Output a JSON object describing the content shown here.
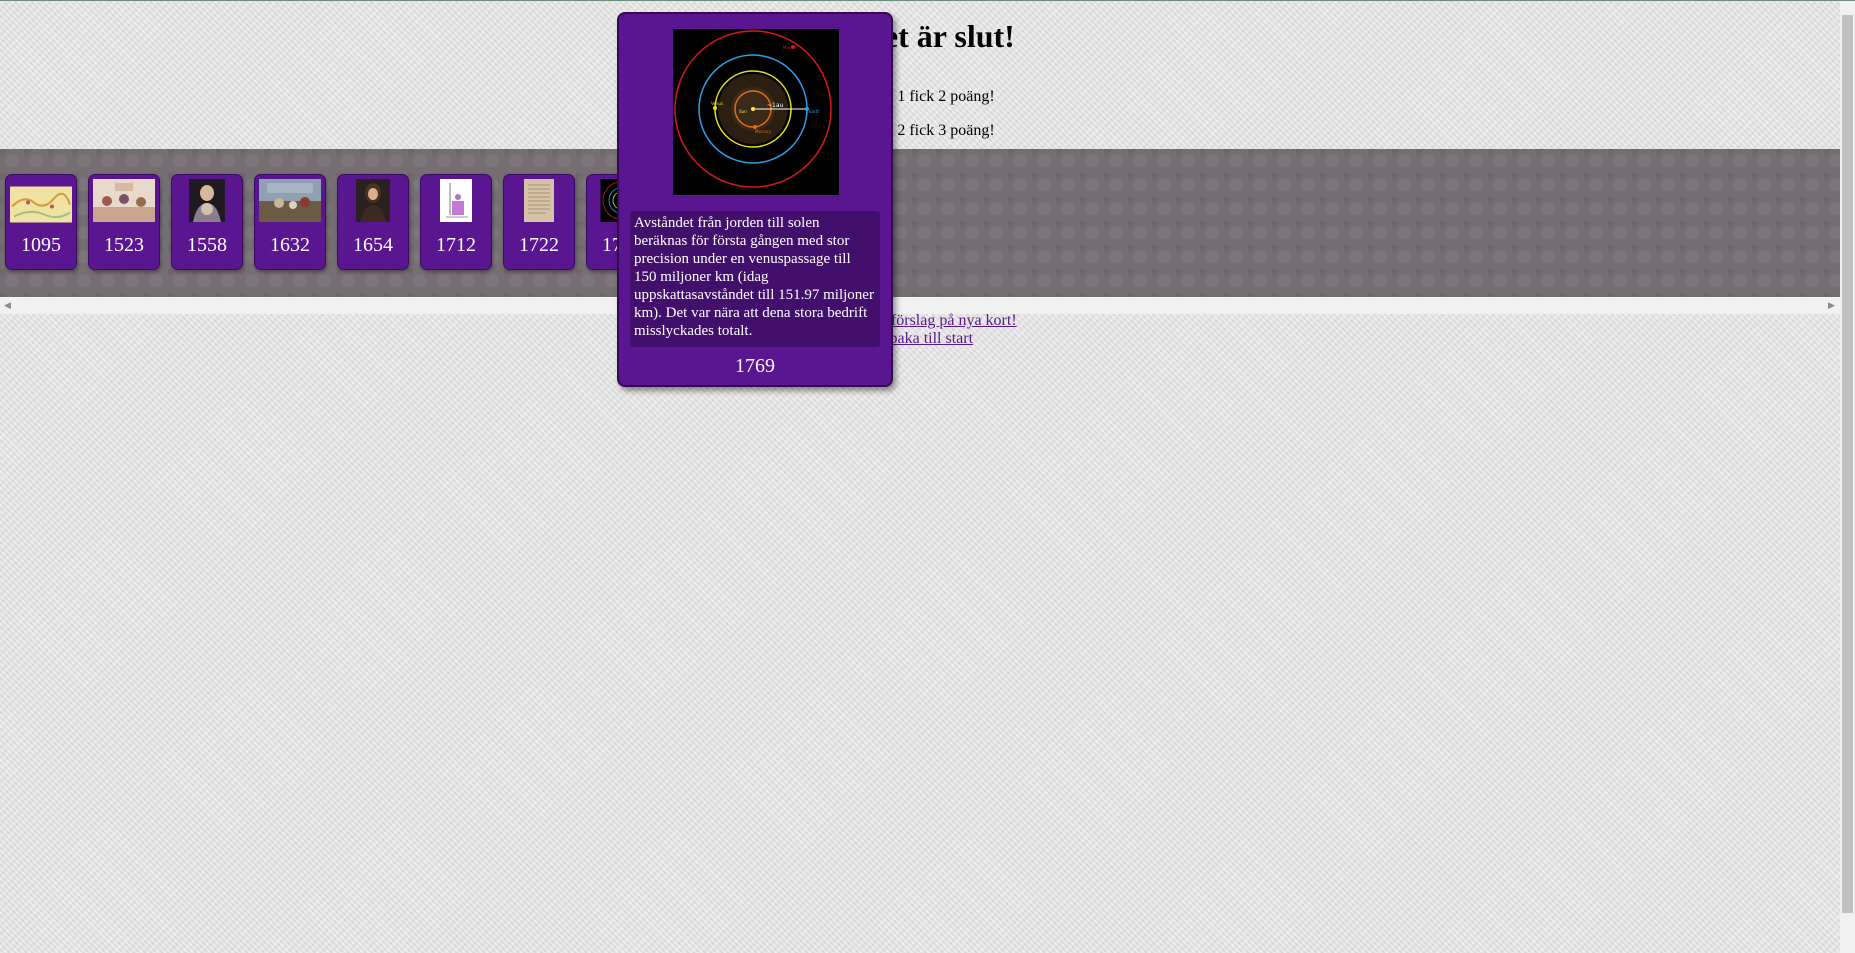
{
  "header": {
    "title": "Spelet är slut!",
    "score_lines": [
      "Spelare 1 fick 2 poäng!",
      "Spelare 2 fick 3 poäng!"
    ]
  },
  "timeline": {
    "cards": [
      {
        "year": "1095",
        "image": "map-thumbnail"
      },
      {
        "year": "1523",
        "image": "painting-thumbnail"
      },
      {
        "year": "1558",
        "image": "portrait-thumbnail"
      },
      {
        "year": "1632",
        "image": "battle-painting-thumbnail"
      },
      {
        "year": "1654",
        "image": "portrait-thumbnail"
      },
      {
        "year": "1712",
        "image": "diagram-thumbnail"
      },
      {
        "year": "1722",
        "image": "document-thumbnail"
      },
      {
        "year": "1769",
        "image": "orbit-diagram-thumbnail"
      }
    ]
  },
  "popup": {
    "description": "Avståndet från jorden till solen beräknas för första gången med stor precision under en venuspassage till 150 miljoner km (idag uppskattasavståndet till 151.97 miljoner km). Det var nära att dena stora bedrift misslyckades totalt.",
    "year": "1769",
    "image_labels": {
      "distance": "~1au",
      "venus": "Venus",
      "earth": "Earth",
      "sun": "Sun",
      "mercury": "Mercury",
      "mars": "Mars"
    }
  },
  "links": {
    "suggest": "Kom med förslag på nya kort!",
    "back": "Tillbaka till start"
  },
  "colors": {
    "card": "#5a1590",
    "board": "#756e73",
    "link": "#551a8b"
  }
}
